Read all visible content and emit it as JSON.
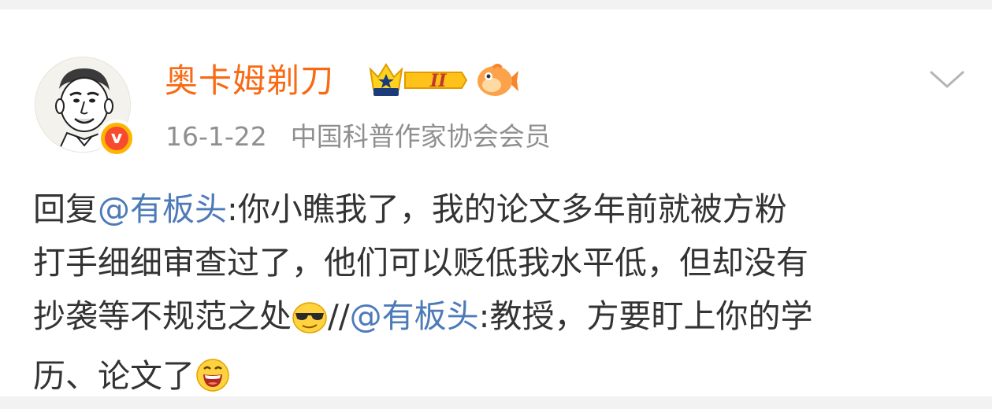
{
  "post": {
    "username": "奥卡姆剃刀",
    "level_badge": "II",
    "date": "16-1-22",
    "verified_title": "中国科普作家协会会员",
    "line1_prefix": "回复",
    "mention1": "@有板头",
    "line1_rest": ":你小瞧我了，我的论文多年前就被方粉",
    "line2": "打手细细审查过了，他们可以贬低我水平低，但却没有",
    "line3_prefix": "抄袭等不规范之处",
    "line3_slashes": "//",
    "mention2": "@有板头",
    "line3_rest": ":教授，方要盯上你的学",
    "line4": "历、论文了"
  },
  "icons": {
    "verified": "verified-v-badge-icon",
    "crown": "crown-level-badge-icon",
    "fish": "fish-fan-icon",
    "chevron": "chevron-down-icon",
    "emoji1": "cool-sunglasses-emoji",
    "emoji2": "laughing-emoji"
  },
  "colors": {
    "username": "#f86a14",
    "mention": "#4d7ab8",
    "body_text": "#333333",
    "meta_text": "#8f8f8f"
  }
}
